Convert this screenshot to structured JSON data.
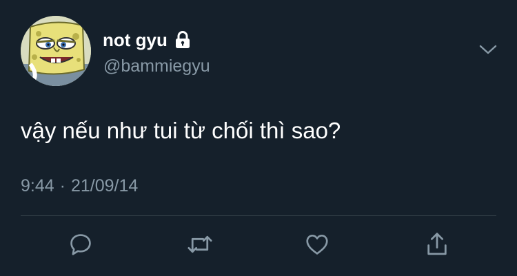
{
  "user": {
    "display_name": "not gyu",
    "handle": "@bammiegyu",
    "protected_icon": "lock-icon",
    "avatar_icon": "spongebob-avatar"
  },
  "tweet": {
    "text": "vậy nếu như tui từ chối thì sao?",
    "time": "9:44",
    "separator": "·",
    "date": "21/09/14"
  },
  "menu_icon": "chevron-down-icon",
  "actions": [
    {
      "name": "reply",
      "icon": "reply-icon"
    },
    {
      "name": "retweet",
      "icon": "retweet-icon"
    },
    {
      "name": "like",
      "icon": "heart-icon"
    },
    {
      "name": "share",
      "icon": "share-icon"
    }
  ],
  "colors": {
    "background": "#15202b",
    "text_primary": "#ffffff",
    "text_secondary": "#8899a6",
    "divider": "#38444d"
  }
}
